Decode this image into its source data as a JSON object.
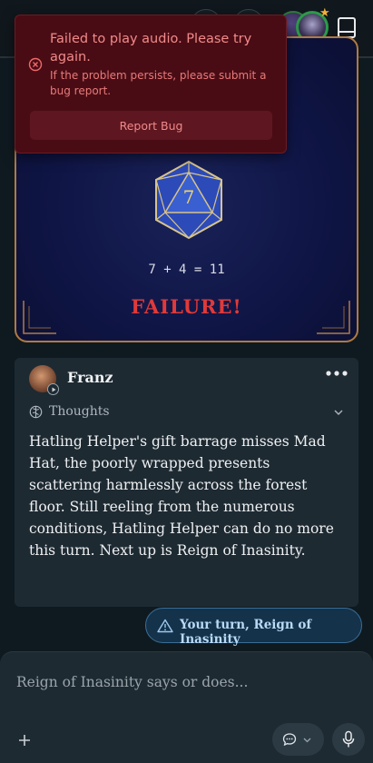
{
  "toast": {
    "title": "Failed to play audio. Please try again.",
    "subtitle": "If the problem persists, please submit a bug report.",
    "button_label": "Report Bug",
    "icon": "error-circle-icon"
  },
  "dice": {
    "die_value": "7",
    "equation": "7 + 4 = 11",
    "result": "FAILURE!",
    "result_color": "#e03a3a"
  },
  "message": {
    "author": "Franz",
    "thoughts_label": "Thoughts",
    "body": "Hatling Helper's gift barrage misses Mad Hat, the poorly wrapped presents scattering harmlessly across the forest floor. Still reeling from the numerous conditions, Hatling Helper can do no more this turn. Next up is Reign of Inasinity."
  },
  "turn_notice": {
    "label": "Your turn, Reign of Inasinity",
    "icon": "warning-triangle-icon"
  },
  "composer": {
    "placeholder": "Reign of Inasinity says or does..."
  },
  "colors": {
    "background": "#0f1a20",
    "card": "#1e2a32",
    "panel_border": "#b07a44",
    "toast_bg": "#4a0c14",
    "accent_blue": "#3a6f98"
  }
}
